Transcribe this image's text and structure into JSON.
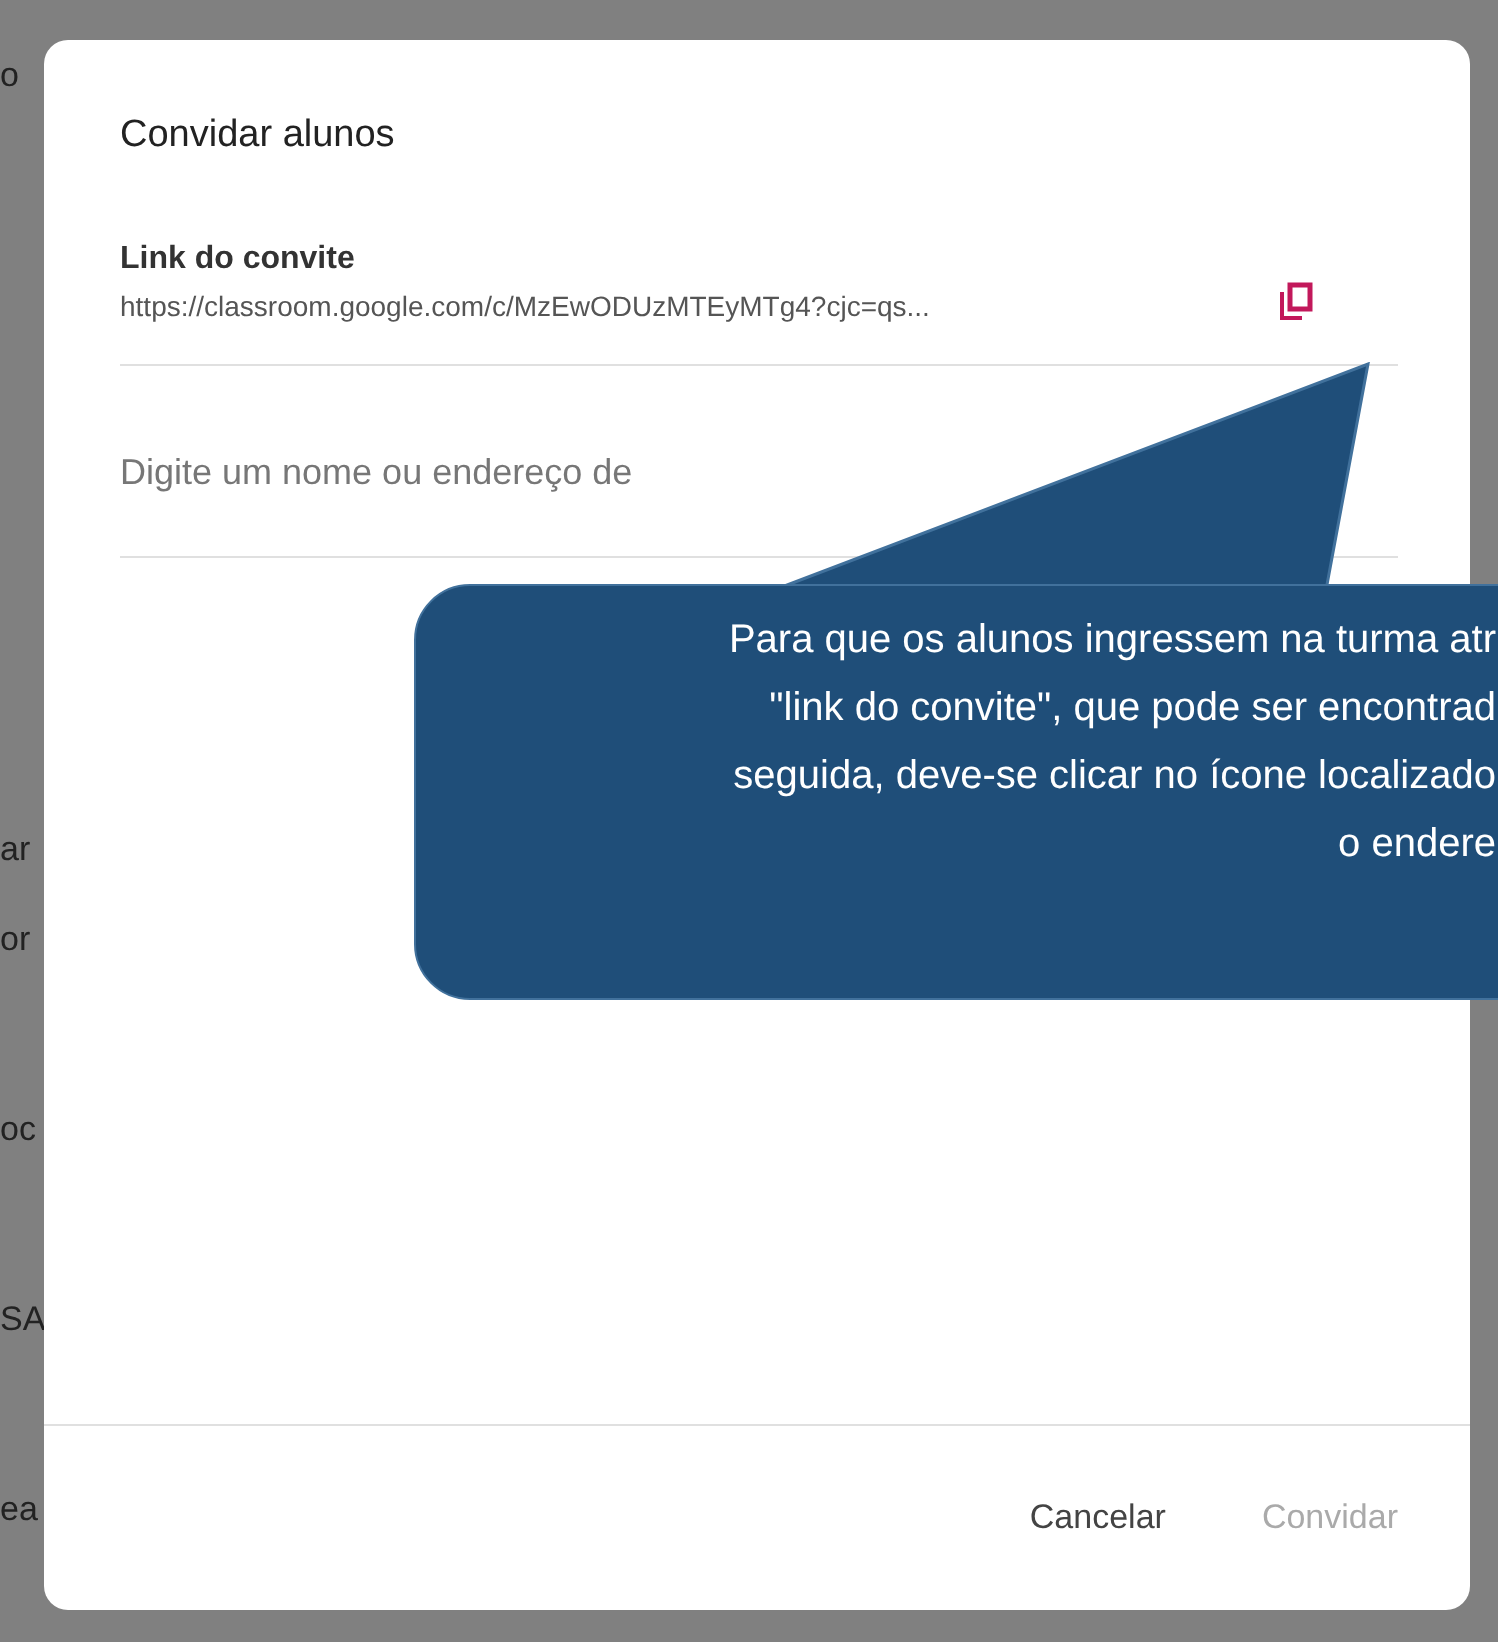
{
  "background_fragments": [
    "o",
    "ar",
    "or",
    "oc",
    "SA",
    "ea"
  ],
  "dialog": {
    "title": "Convidar alunos",
    "link_label": "Link do convite",
    "link_url": "https://classroom.google.com/c/MzEwODUzMTEyMTg4?cjc=qs...",
    "input": {
      "placeholder": "Digite um nome ou endereço de"
    },
    "buttons": [
      {
        "label": "Cancelar",
        "disabled": false
      },
      {
        "label": "Convidar",
        "disabled": true
      }
    ]
  },
  "callout": {
    "lines": [
      "Para que os alunos ingressem na turma atr",
      "\"link do convite\", que pode ser encontrad",
      "seguida, deve-se clicar no ícone localizado",
      "o endere"
    ]
  }
}
